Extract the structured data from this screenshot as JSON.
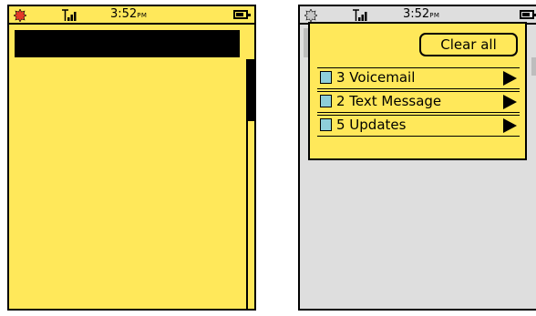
{
  "colors": {
    "screen_yellow": "#ffe85a",
    "backdrop_grey": "#dedede",
    "notification_box": "#8ecfda",
    "alert_red": "#e43a28"
  },
  "left_phone": {
    "status_bar": {
      "alert_icon": "sun-alert-icon",
      "signal_icon": "signal-icon",
      "time": "3:52",
      "time_suffix": "PM",
      "battery_icon": "battery-icon"
    }
  },
  "right_phone": {
    "status_bar": {
      "alert_icon": "sun-alert-icon",
      "signal_icon": "signal-icon",
      "time": "3:52",
      "time_suffix": "PM",
      "battery_icon": "battery-icon"
    },
    "notifications": {
      "clear_all_label": "Clear all",
      "items": [
        {
          "label": "3 Voicemail"
        },
        {
          "label": "2 Text Message"
        },
        {
          "label": "5 Updates"
        }
      ]
    }
  }
}
